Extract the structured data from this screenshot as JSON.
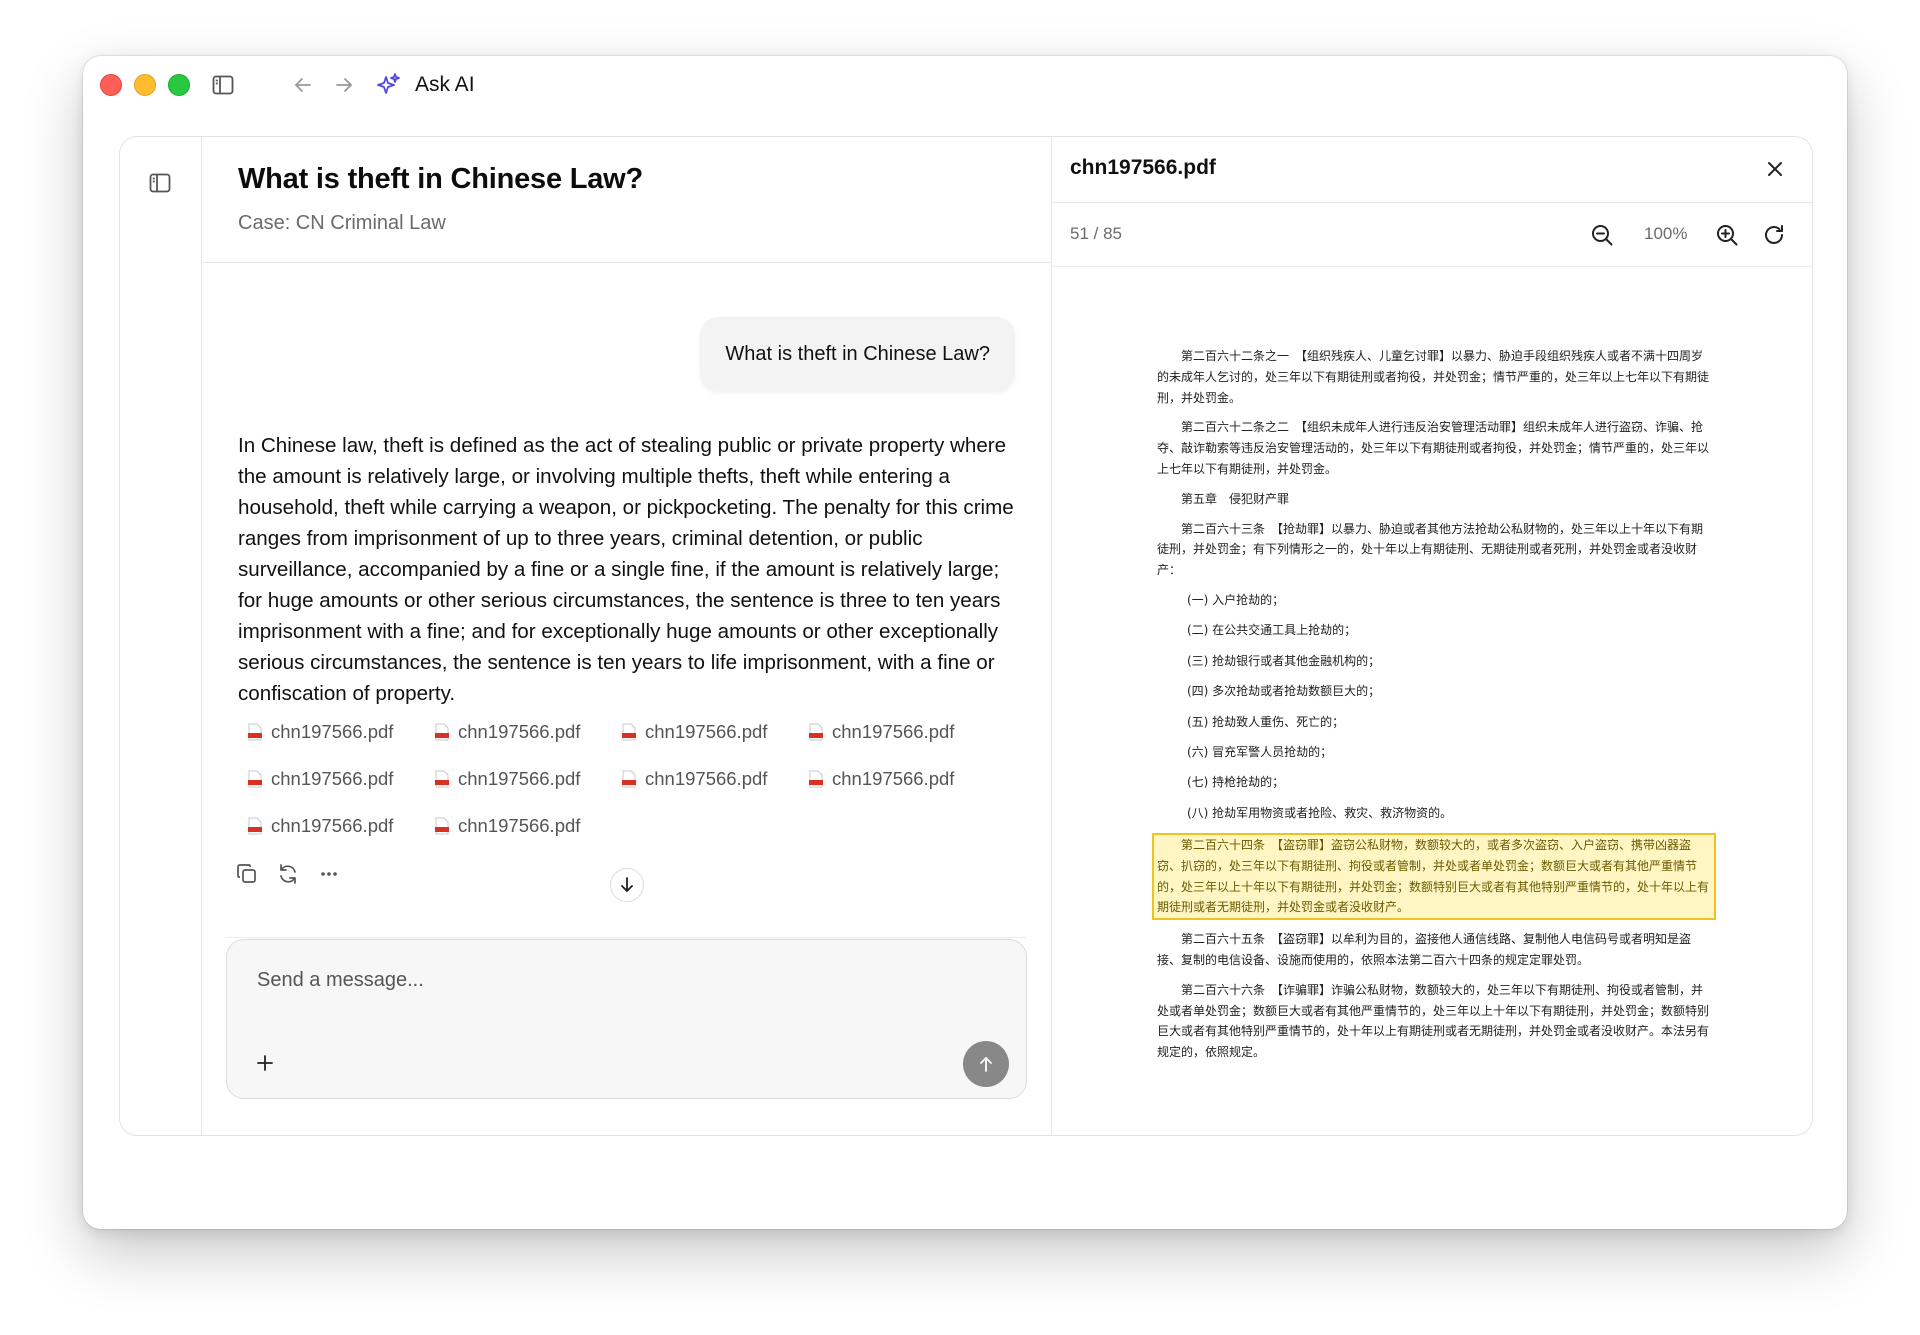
{
  "window": {
    "title": "Ask AI"
  },
  "chat": {
    "title": "What is theft in Chinese Law?",
    "subtitle": "Case: CN Criminal Law",
    "user_message": "What is theft in Chinese Law?",
    "answer": "In Chinese law, theft is defined as the act of stealing public or private property where the amount is relatively large, or involving multiple thefts, theft while entering a household, theft while carrying a weapon, or pickpocketing. The penalty for this crime ranges from imprisonment of up to three years, criminal detention, or public surveillance, accompanied by a fine or a single fine, if the amount is relatively large; for huge amounts or other serious circumstances, the sentence is three to ten years imprisonment with a fine; and for exceptionally huge amounts or other exceptionally serious circumstances, the sentence is ten years to life imprisonment, with a fine or confiscation of property.",
    "sources": [
      "chn197566.pdf",
      "chn197566.pdf",
      "chn197566.pdf",
      "chn197566.pdf",
      "chn197566.pdf",
      "chn197566.pdf",
      "chn197566.pdf",
      "chn197566.pdf",
      "chn197566.pdf",
      "chn197566.pdf"
    ],
    "composer_placeholder": "Send a message..."
  },
  "icons": {
    "sidebar_toggle": "sidebar-icon",
    "back": "arrow-left-icon",
    "forward": "arrow-right-icon",
    "app": "sparkles-icon",
    "copy": "copy-icon",
    "regenerate": "refresh-icon",
    "more": "more-icon",
    "scroll_down": "arrow-down-icon",
    "attach": "plus-icon",
    "send": "arrow-up-icon",
    "close": "close-icon",
    "zoom_out": "zoom-out-icon",
    "zoom_in": "zoom-in-icon",
    "rotate": "rotate-icon",
    "pdf": "pdf-file-icon"
  },
  "colors": {
    "traffic_red": "#ff5f57",
    "traffic_yellow": "#febc2e",
    "traffic_green": "#28c840",
    "app_icon": "#4f46e5",
    "highlight_fill": "#fff6c4",
    "highlight_border": "#f0c21e",
    "pdf_icon": "#d93025"
  },
  "viewer": {
    "filename": "chn197566.pdf",
    "page_indicator": "51 / 85",
    "zoom": "100%",
    "page": {
      "p1": "第二百六十二条之一　【组织残疾人、儿童乞讨罪】以暴力、胁迫手段组织残疾人或者不满十四周岁的未成年人乞讨的，处三年以下有期徒刑或者拘役，并处罚金；情节严重的，处三年以上七年以下有期徒刑，并处罚金。",
      "p2": "第二百六十二条之二　【组织未成年人进行违反治安管理活动罪】组织未成年人进行盗窃、诈骗、抢夺、敲诈勒索等违反治安管理活动的，处三年以下有期徒刑或者拘役，并处罚金；情节严重的，处三年以上七年以下有期徒刑，并处罚金。",
      "chapter": "第五章　侵犯财产罪",
      "p3": "第二百六十三条　【抢劫罪】以暴力、胁迫或者其他方法抢劫公私财物的，处三年以上十年以下有期徒刑，并处罚金；有下列情形之一的，处十年以上有期徒刑、无期徒刑或者死刑，并处罚金或者没收财产：",
      "items": [
        "(一) 入户抢劫的；",
        "(二) 在公共交通工具上抢劫的；",
        "(三) 抢劫银行或者其他金融机构的；",
        "(四) 多次抢劫或者抢劫数额巨大的；",
        "(五) 抢劫致人重伤、死亡的；",
        "(六) 冒充军警人员抢劫的；",
        "(七) 持枪抢劫的；",
        "(八) 抢劫军用物资或者抢险、救灾、救济物资的。"
      ],
      "highlight": "第二百六十四条　【盗窃罪】盗窃公私财物，数额较大的，或者多次盗窃、入户盗窃、携带凶器盗窃、扒窃的，处三年以下有期徒刑、拘役或者管制，并处或者单处罚金；数额巨大或者有其他严重情节的，处三年以上十年以下有期徒刑，并处罚金；数额特别巨大或者有其他特别严重情节的，处十年以上有期徒刑或者无期徒刑，并处罚金或者没收财产。",
      "p4": "第二百六十五条　【盗窃罪】以牟利为目的，盗接他人通信线路、复制他人电信码号或者明知是盗接、复制的电信设备、设施而使用的，依照本法第二百六十四条的规定定罪处罚。",
      "p5": "第二百六十六条　【诈骗罪】诈骗公私财物，数额较大的，处三年以下有期徒刑、拘役或者管制，并处或者单处罚金；数额巨大或者有其他严重情节的，处三年以上十年以下有期徒刑，并处罚金；数额特别巨大或者有其他特别严重情节的，处十年以上有期徒刑或者无期徒刑，并处罚金或者没收财产。本法另有规定的，依照规定。"
    }
  }
}
